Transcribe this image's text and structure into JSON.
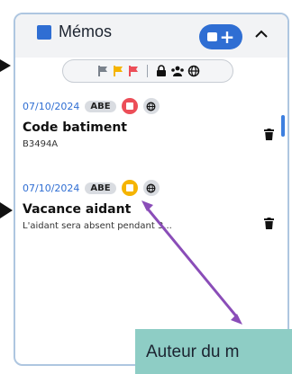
{
  "header": {
    "title": "Mémos",
    "add_button": "+",
    "collapse_icon": "chevron-up"
  },
  "filters": {
    "flag_icons": [
      "gray-flag",
      "yellow-flag",
      "red-flag"
    ],
    "visibility_icons": [
      "lock-icon",
      "group-icon",
      "globe-icon"
    ]
  },
  "memos": [
    {
      "date": "07/10/2024",
      "author": "ABE",
      "flag_color": "#ec4e58",
      "title": "Code batiment",
      "body": "B3494A"
    },
    {
      "date": "07/10/2024",
      "author": "ABE",
      "flag_color": "#f5b400",
      "title": "Vacance aidant",
      "body": "L'aidant sera absent pendant 3..."
    }
  ],
  "annotation": {
    "text": "Auteur du m"
  },
  "colors": {
    "accent": "#2f6ed3",
    "panel_border": "#aec6e0",
    "annotation_bg": "#8ecdc5",
    "arrow": "#8a4db8"
  }
}
